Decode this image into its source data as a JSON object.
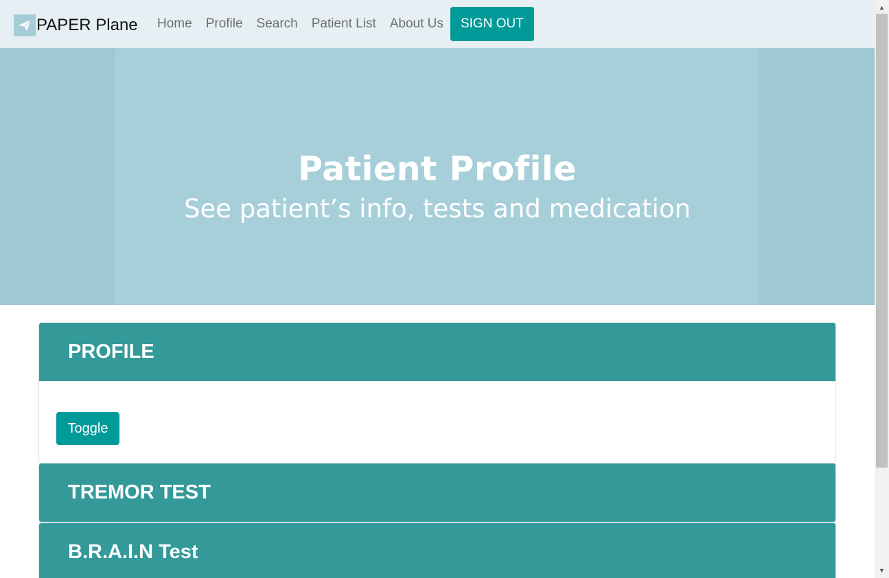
{
  "navbar": {
    "brand": "PAPER Plane",
    "brand_icon": "paper-plane-icon",
    "links": [
      {
        "label": "Home"
      },
      {
        "label": "Profile"
      },
      {
        "label": "Search"
      },
      {
        "label": "Patient List"
      },
      {
        "label": "About Us"
      }
    ],
    "signout_label": "SIGN OUT"
  },
  "hero": {
    "title": "Patient Profile",
    "subtitle": "See patient’s info, tests and medication"
  },
  "panels": [
    {
      "title": "PROFILE",
      "toggle_label": "Toggle"
    },
    {
      "title": "TREMOR TEST"
    },
    {
      "title": "B.R.A.I.N Test"
    }
  ],
  "colors": {
    "accent": "#009a98",
    "panel_header": "#339a99",
    "hero_bg": "#a7cfd9",
    "navbar_bg": "#e6eff3"
  }
}
